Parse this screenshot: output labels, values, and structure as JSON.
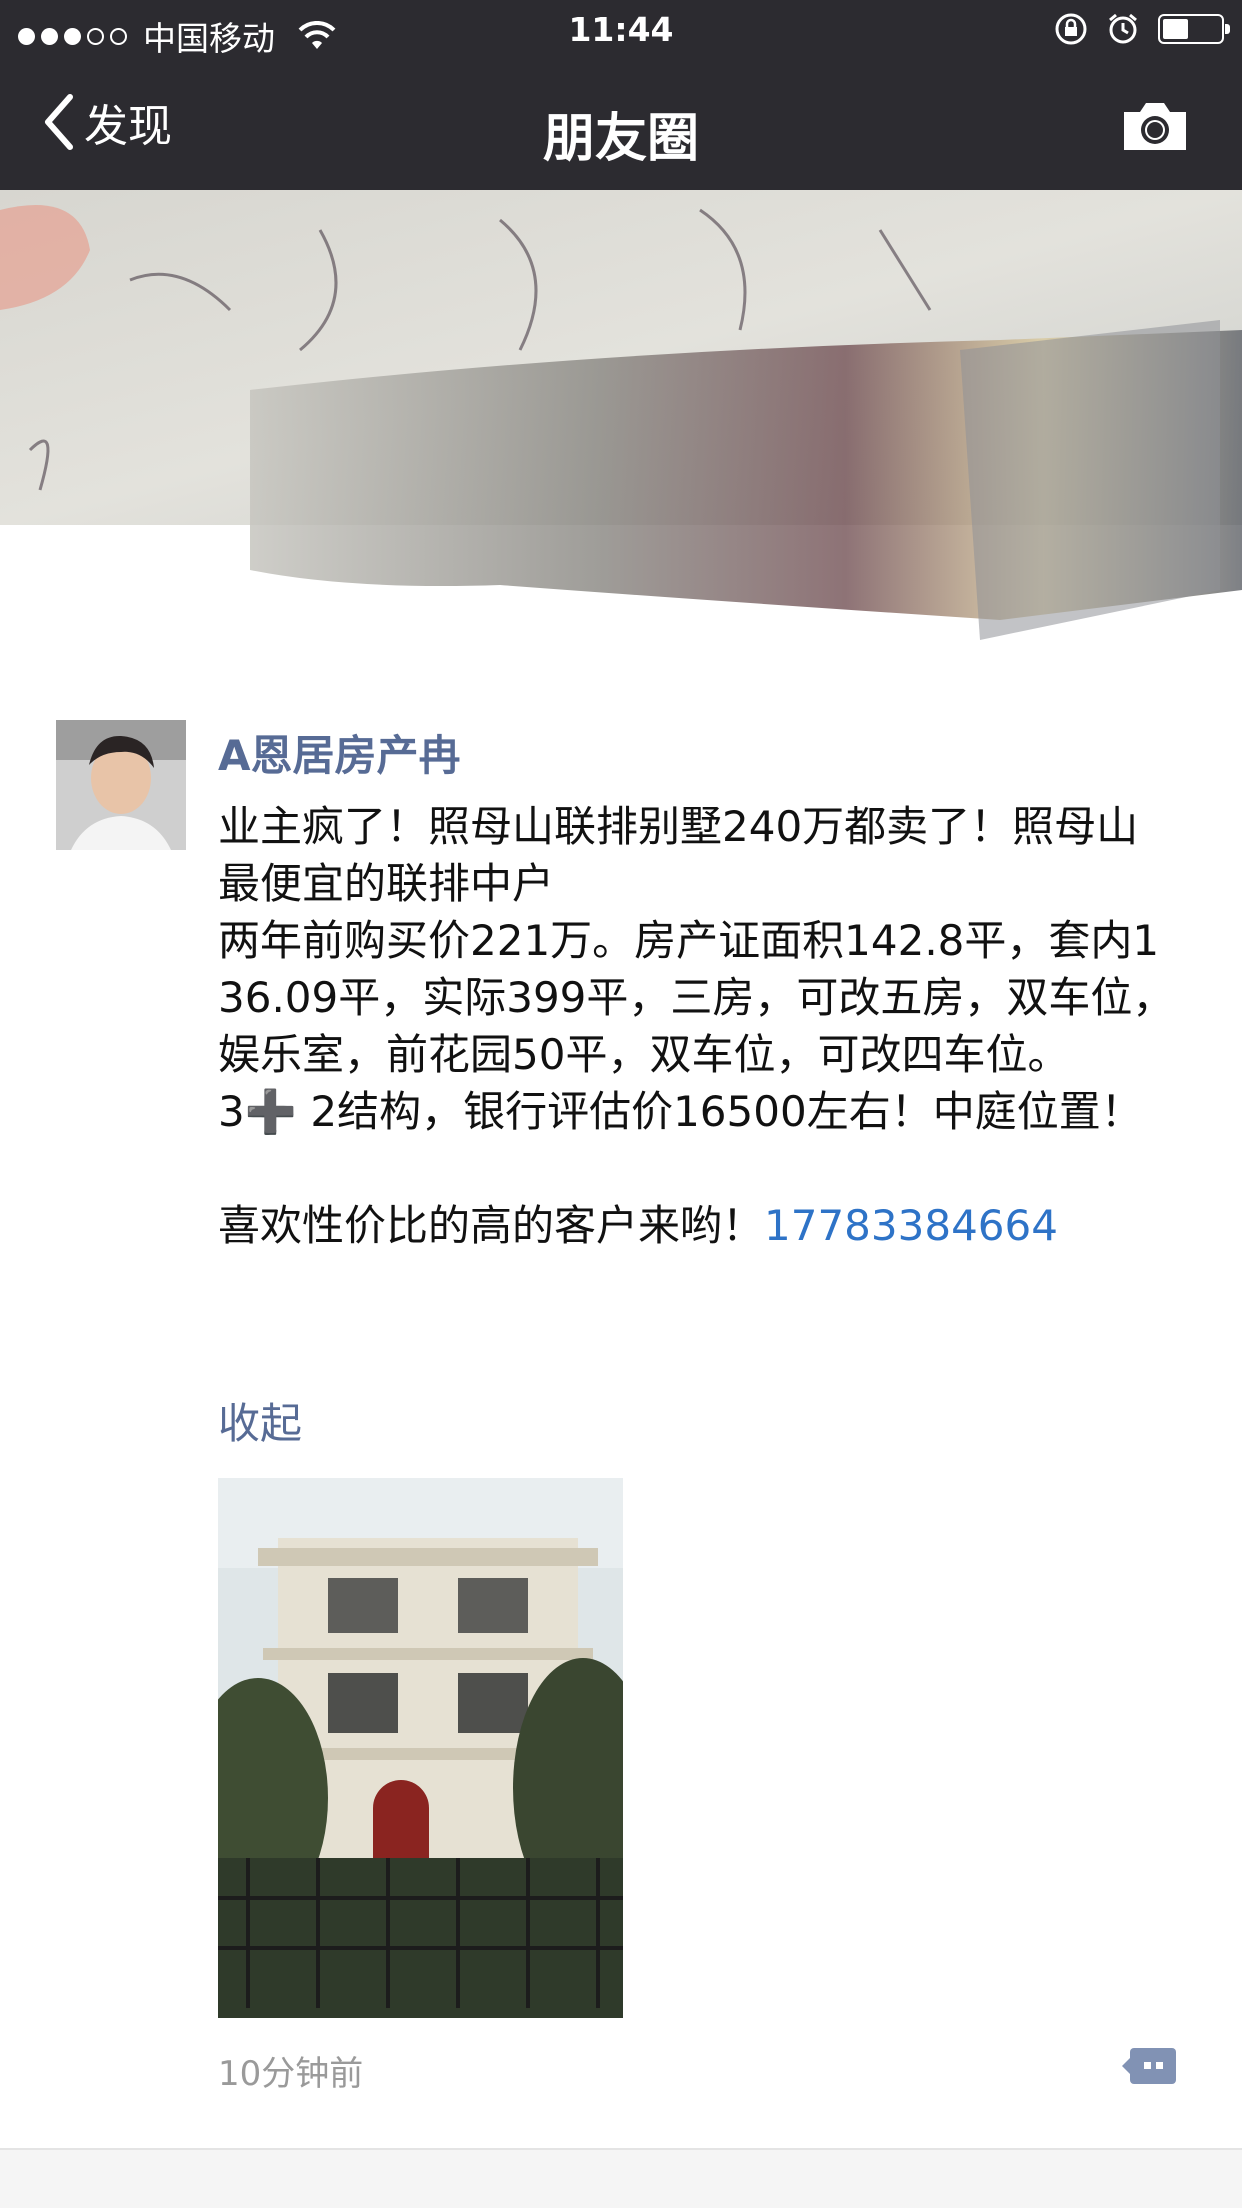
{
  "status_bar": {
    "carrier": "中国移动",
    "time": "11:44",
    "signal_bars_filled": 3,
    "signal_bars_total": 5,
    "battery_level": 0.45
  },
  "nav": {
    "back_label": "发现",
    "title": "朋友圈"
  },
  "post": {
    "author": "A恩居房产冉",
    "text": "业主疯了！照母山联排别墅240万都卖了！照母山最便宜的联排中户\n两年前购买价221万。房产证面积142.8平，套内136.09平，实际399平，三房，可改五房，双车位，娱乐室，前花园50平，双车位，可改四车位。\n3➕ 2结构，银行评估价16500左右！中庭位置！\n\n喜欢性价比的高的客户来哟！",
    "phone": "17783384664",
    "collapse_label": "收起",
    "timestamp": "10分钟前"
  },
  "icons": {
    "back": "chevron-left-icon",
    "camera": "camera-icon",
    "comment": "comment-icon",
    "wifi": "wifi-icon",
    "lock_rotation": "rotation-lock-icon",
    "alarm": "alarm-icon",
    "battery": "battery-icon"
  },
  "colors": {
    "bar_bg": "#2c2b30",
    "name": "#576b95",
    "link": "#2e73c7",
    "timestamp": "#9a9a9a"
  }
}
